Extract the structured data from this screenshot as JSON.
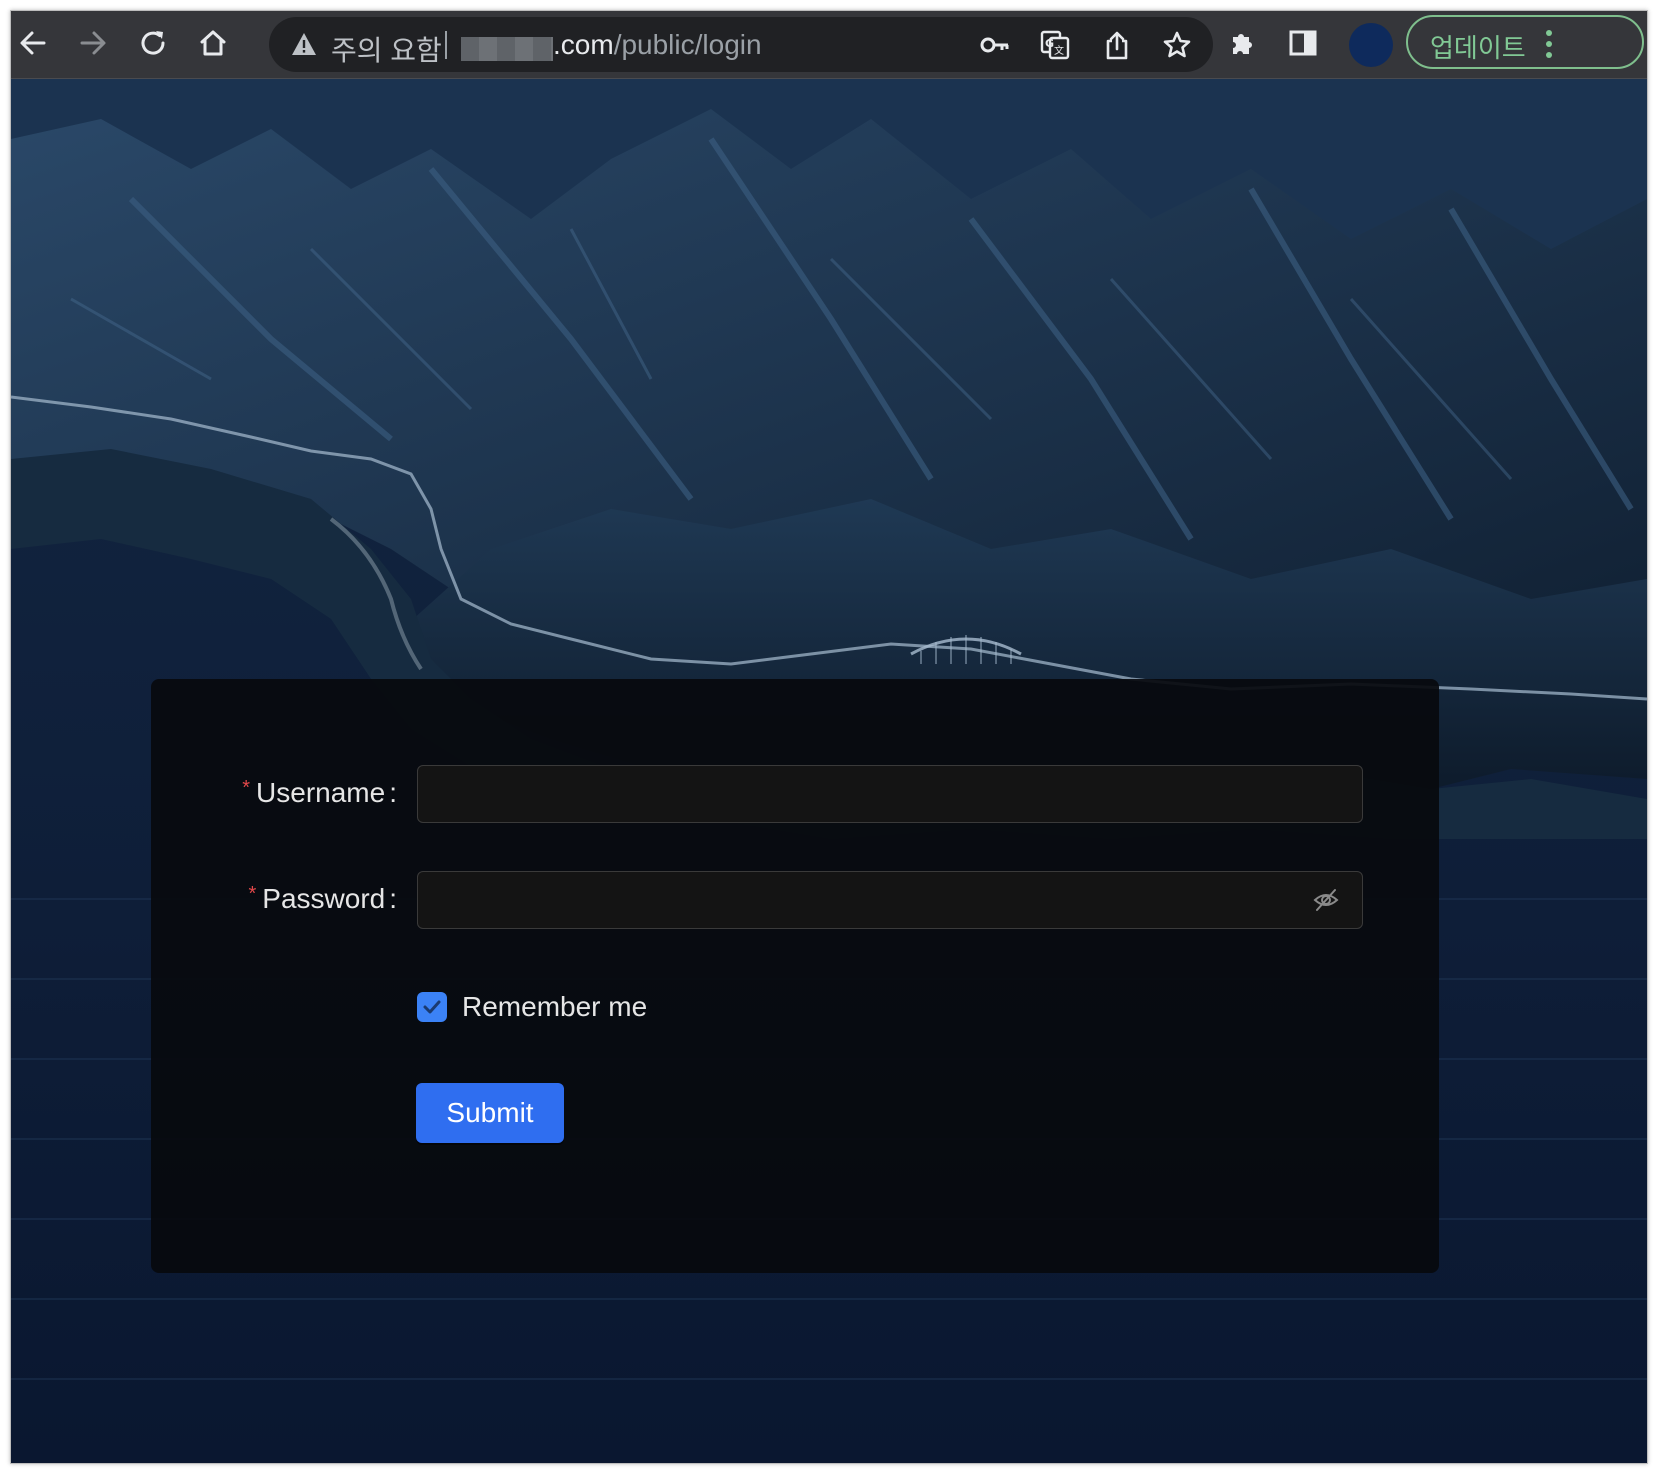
{
  "browser": {
    "security_label": "주의 요함",
    "url_domain": ".com",
    "url_path": "/public/login",
    "update_label": "업데이트",
    "toolbar_icons": [
      "back-icon",
      "forward-icon",
      "reload-icon",
      "home-icon",
      "key-icon",
      "translate-icon",
      "share-icon",
      "bookmark-star-icon",
      "extensions-icon",
      "side-panel-icon",
      "profile-avatar",
      "menu-dots-icon"
    ],
    "colors": {
      "toolbar": "#35363a",
      "omnibox": "#202124",
      "update_accent": "#81c995",
      "profile": "#0e2a5c"
    }
  },
  "login_form": {
    "username_label": "Username",
    "password_label": "Password",
    "required_mark": "*",
    "label_colon": ":",
    "username_value": "",
    "password_value": "",
    "remember_label": "Remember me",
    "remember_checked": true,
    "submit_label": "Submit",
    "colors": {
      "primary": "#2f6ef0",
      "checkbox": "#3b82f6",
      "required": "#e2484a",
      "card_bg": "#08090c"
    }
  }
}
